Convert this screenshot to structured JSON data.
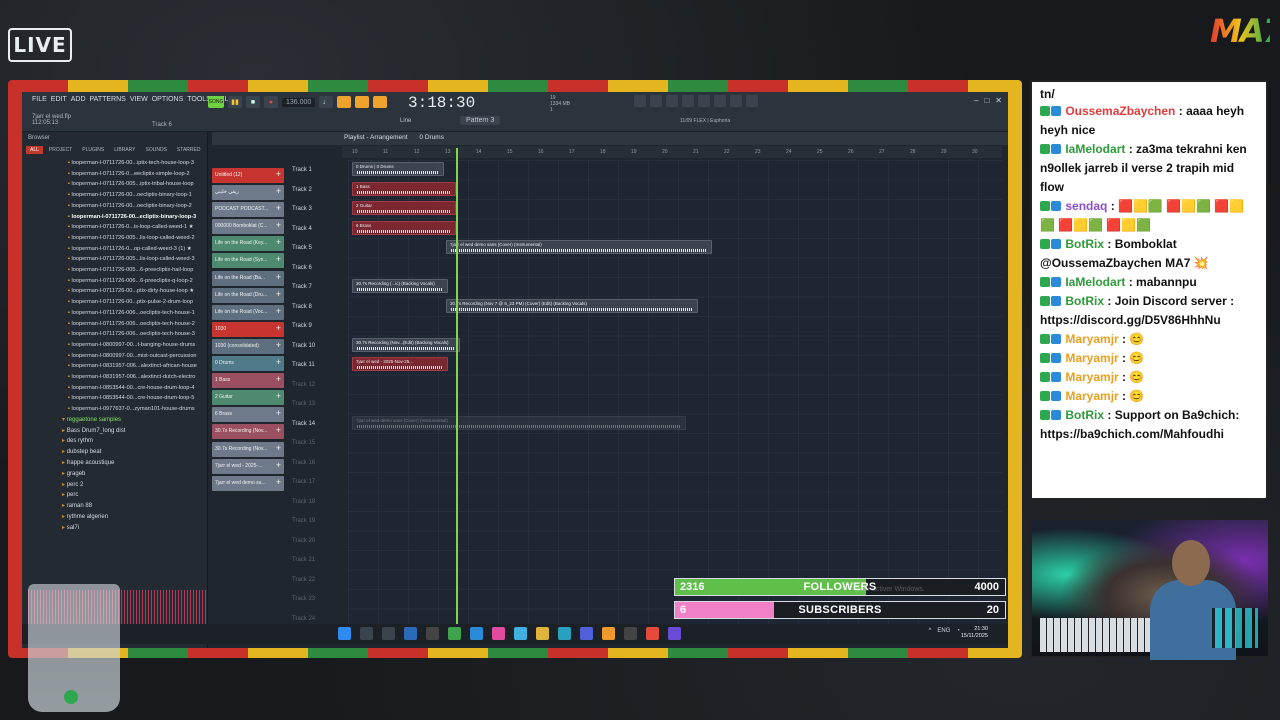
{
  "overlay": {
    "live_badge": "LIVE",
    "brand_logo": "MA7",
    "watermark": "pour activer Windows."
  },
  "daw": {
    "menu": [
      "FILE",
      "EDIT",
      "ADD",
      "PATTERNS",
      "VIEW",
      "OPTIONS",
      "TOOLS",
      "HELP"
    ],
    "song_file": "7jarr el wed.flp",
    "song_time": "112:05:13",
    "song_track": "Track 6",
    "bpm": "136.000",
    "time_display": "3:18:30",
    "time_suffix": "M:S:CS",
    "cpu_label": "19",
    "ram_label": "1334 MB",
    "cpu_sub": "1",
    "pattern": "Pattern 3",
    "snap": "Line",
    "plugin_info": "11/09  FLEX | Euphoria",
    "window_controls": [
      "–",
      "□",
      "✕"
    ],
    "browser": {
      "title": "Browser",
      "tabs": [
        "ALL",
        "PROJECT",
        "PLUGINS",
        "LIBRARY",
        "SOUNDS",
        "STARRED"
      ],
      "files": [
        "looperman-l-0711726-00...iptix-tech-house-loop-3",
        "looperman-l-0711726-0...eecliptix-simple-loop-2",
        "looperman-l-0711726-005...iptix-tribal-house-loop",
        "looperman-l-0711726-00...oecliptix-binary-loop-1",
        "looperman-l-0711726-00...oecliptix-binary-loop-2",
        "looperman-l-0711726-00...ecliptix-binary-loop-3",
        "looperman-l-0711726-0...is-loop-called-weed-1 ★",
        "looperman-l-0711726-005...lis-loop-called-weed-2",
        "looperman-l-0711726-0...op-called-weed-3 (1) ★",
        "looperman-l-0711726-005...lis-loop-called-weed-3",
        "looperman-l-0711726-005...6-preecliptix-hail-loop",
        "looperman-l-0711726-006...6-preecliptix-q-loop-2",
        "looperman-l-0711726-00...ptix-dirty-house-loop ★",
        "looperman-l-0711726-00...ptix-pulse-2-drum-loop",
        "looperman-l-0711726-006...oecliptix-tech-house-1",
        "looperman-l-0711726-006...oecliptix-tech-house-2",
        "looperman-l-0711726-006...oecliptix-tech-house-3",
        "looperman-l-0800997-00...t-banging-house-drums",
        "looperman-l-0800997-00...mist-outcast-percussion",
        "looperman-l-0831957-006...alextinct-african-house",
        "looperman-l-0831957-006...alextinct-dutch-electro",
        "looperman-l-0853544-00...cre-house-drum-loop-4",
        "looperman-l-0853544-00...cre-house-drum-loop-5",
        "looperman-l-0977637-0...zyman101-house-drums"
      ],
      "folders": [
        {
          "name": "reggaetone samples",
          "open": true
        },
        {
          "name": "Bass Drum7_long dist",
          "open": false
        },
        {
          "name": "des rythm",
          "open": false
        },
        {
          "name": "dubstep beat",
          "open": false
        },
        {
          "name": "frappe acoustique",
          "open": false
        },
        {
          "name": "grageb",
          "open": false
        },
        {
          "name": "perc 2",
          "open": false
        },
        {
          "name": "perc",
          "open": false
        },
        {
          "name": "raman 88",
          "open": false
        },
        {
          "name": "rythme algerien",
          "open": false
        },
        {
          "name": "sal7i",
          "open": false
        }
      ]
    },
    "channels": [
      {
        "name": "Untitled (12)",
        "color": "#c8342f"
      },
      {
        "name": "ريقي خليني",
        "color": "#6e7a8a"
      },
      {
        "name": "PODCAST PODCAST...",
        "color": "#6e7a8a"
      },
      {
        "name": "000000 Bomboklat (C...",
        "color": "#6e7a8a"
      },
      {
        "name": "Life on the Road (Key...",
        "color": "#4e8a6f"
      },
      {
        "name": "Life on the Road (Syn...",
        "color": "#4e8a6f"
      },
      {
        "name": "Life on the Road (Ba...",
        "color": "#5e6f80"
      },
      {
        "name": "Life on the Road (Dru...",
        "color": "#5e6f80"
      },
      {
        "name": "Life on the Road (Voc...",
        "color": "#5e6f80"
      },
      {
        "name": "1030",
        "color": "#c8342f"
      },
      {
        "name": "1030 (consolidated)",
        "color": "#5e6f80"
      },
      {
        "name": "0 Drums",
        "color": "#4e7a8a"
      },
      {
        "name": "1 Bass",
        "color": "#9a5060"
      },
      {
        "name": "2 Guitar",
        "color": "#4e8a6f"
      },
      {
        "name": "6 Brass",
        "color": "#6e7a8a"
      },
      {
        "name": "30.7s Recording (Nov...",
        "color": "#9a5060"
      },
      {
        "name": "30.7s Recording (Nov...",
        "color": "#6e7a8a"
      },
      {
        "name": "7jarr el wed - 2025-...",
        "color": "#6e7a8a"
      },
      {
        "name": "7jarr el wed demo su...",
        "color": "#6e7a8a"
      }
    ],
    "playlist": {
      "title": "Playlist - Arrangement",
      "pattern": "0 Drums",
      "timeline_marks": [
        "10",
        "11",
        "12",
        "13",
        "14",
        "15",
        "16",
        "17",
        "18",
        "19",
        "20",
        "21",
        "22",
        "23",
        "24",
        "25",
        "26",
        "27",
        "28",
        "29",
        "30"
      ],
      "tracks": [
        "Track 1",
        "Track 2",
        "Track 3",
        "Track 4",
        "Track 5",
        "Track 6",
        "Track 7",
        "Track 8",
        "Track 9",
        "Track 10",
        "Track 11",
        "Track 12",
        "Track 13",
        "Track 14",
        "Track 15",
        "Track 16",
        "Track 17",
        "Track 18",
        "Track 19",
        "Track 20",
        "Track 21",
        "Track 22",
        "Track 23",
        "Track 24"
      ],
      "clips": [
        {
          "label": "0 Drums  |  0 Drums"
        },
        {
          "label": "1 Bass"
        },
        {
          "label": "2 Guitar"
        },
        {
          "label": "6 Brass"
        },
        {
          "label": "7jarr el wed demo sans (Cover) (Instrumental)"
        },
        {
          "label": "30.7s Recording (...ic) (Backing Vocals)"
        },
        {
          "label": "30.7s Recording (Nov 7 @ 6_23 PM) (Cover) (Edit) (Backing Vocals)"
        },
        {
          "label": "30.7s Recording (Nov...(Edit) (Backing Vocals)"
        },
        {
          "label": "7jarr el wed - 2025-Nov-25..."
        },
        {
          "label": "7jarr el wed demo sans (Cover) (Instrumental)"
        }
      ]
    },
    "taskbar": {
      "lang": "ENG",
      "time": "21:30",
      "date": "15/11/2025"
    }
  },
  "goals": {
    "followers": {
      "label": "FOLLOWERS",
      "current": "2316",
      "target": "4000",
      "progress": 0.579,
      "color": "#5fbf4a"
    },
    "subscribers": {
      "label": "SUBSCRIBERS",
      "current": "6",
      "target": "20",
      "progress": 0.3,
      "color": "#f080c8"
    }
  },
  "chat": {
    "top_fragment": "tn/",
    "messages": [
      {
        "user": "OussemaZbaychen",
        "color": "#e23b3b",
        "text": "aaaa heyh heyh nice"
      },
      {
        "user": "IaMelodart",
        "color": "#2f9a3a",
        "text": "za3ma tekrahni ken n9ollek jarreb il verse 2 trapih mid flow"
      },
      {
        "user": "sendaq",
        "color": "#8a4fc8",
        "text": "🟥🟨🟩 🟥🟨🟩 🟥🟨🟩 🟥🟨🟩 🟥🟨🟩"
      },
      {
        "user": "BotRix",
        "color": "#2f9a3a",
        "text": "Bomboklat @OussemaZbaychen MA7 💥"
      },
      {
        "user": "IaMelodart",
        "color": "#2f9a3a",
        "text": "mabannpu"
      },
      {
        "user": "BotRix",
        "color": "#2f9a3a",
        "text": "Join Discord server : https://discord.gg/D5V86HhhNu"
      },
      {
        "user": "Maryamjr",
        "color": "#e8a020",
        "text": "😊"
      },
      {
        "user": "Maryamjr",
        "color": "#e8a020",
        "text": "😊"
      },
      {
        "user": "Maryamjr",
        "color": "#e8a020",
        "text": "😊"
      },
      {
        "user": "Maryamjr",
        "color": "#e8a020",
        "text": "😊"
      },
      {
        "user": "BotRix",
        "color": "#2f9a3a",
        "text": "Support on Ba9chich: https://ba9chich.com/Mahfoudhi"
      }
    ]
  }
}
